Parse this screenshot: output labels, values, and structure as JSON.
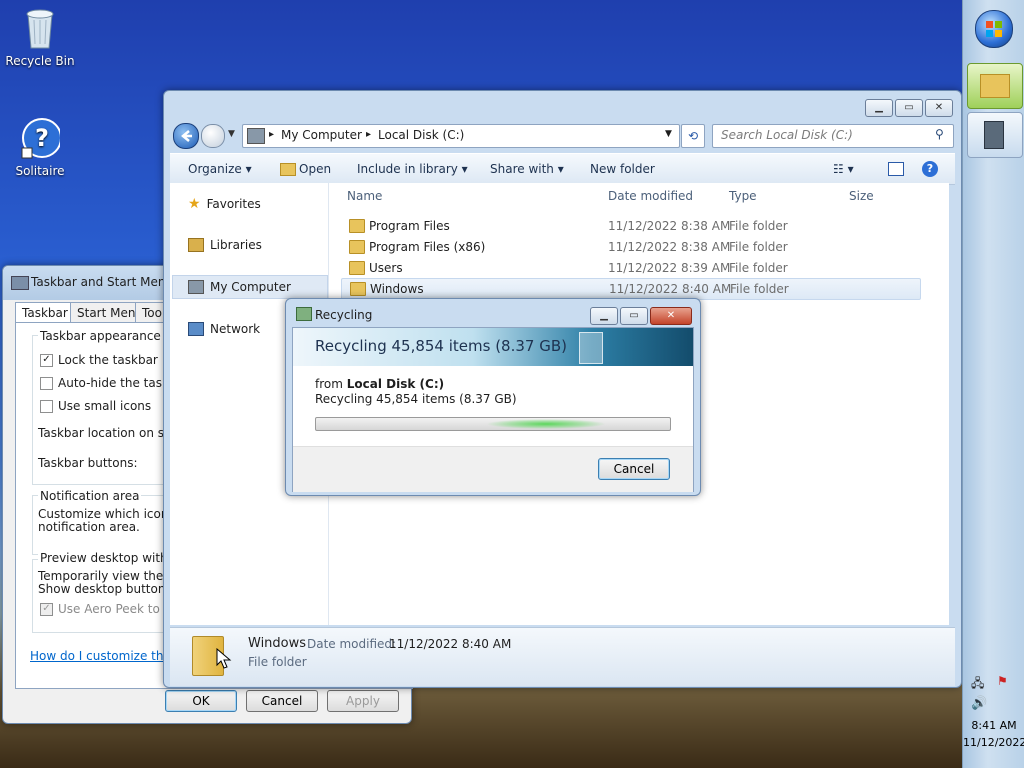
{
  "desktop": {
    "icons": [
      {
        "label": "Recycle Bin",
        "icon": "recycle-bin-icon"
      },
      {
        "label": "Solitaire",
        "icon": "help-icon"
      }
    ]
  },
  "taskbar": {
    "time": "8:41 AM",
    "date": "11/12/2022"
  },
  "explorer": {
    "breadcrumb": [
      "My Computer",
      "Local Disk (C:)"
    ],
    "search_placeholder": "Search Local Disk (C:)",
    "toolbar": {
      "organize": "Organize",
      "open": "Open",
      "include": "Include in library",
      "share": "Share with",
      "newfolder": "New folder"
    },
    "nav": {
      "favorites": "Favorites",
      "libraries": "Libraries",
      "computer": "My Computer",
      "network": "Network"
    },
    "columns": {
      "name": "Name",
      "date": "Date modified",
      "type": "Type",
      "size": "Size"
    },
    "rows": [
      {
        "name": "Program Files",
        "date": "11/12/2022 8:38 AM",
        "type": "File folder"
      },
      {
        "name": "Program Files (x86)",
        "date": "11/12/2022 8:38 AM",
        "type": "File folder"
      },
      {
        "name": "Users",
        "date": "11/12/2022 8:39 AM",
        "type": "File folder"
      },
      {
        "name": "Windows",
        "date": "11/12/2022 8:40 AM",
        "type": "File folder"
      }
    ],
    "details": {
      "name": "Windows",
      "date_label": "Date modified:",
      "date": "11/12/2022 8:40 AM",
      "type": "File folder"
    }
  },
  "taskbar_props": {
    "title": "Taskbar and Start Menu P",
    "tabs": [
      "Taskbar",
      "Start Menu",
      "Toolb"
    ],
    "appearance": "Taskbar appearance",
    "lock": "Lock the taskbar",
    "autohide": "Auto-hide the taskbar",
    "small": "Use small icons",
    "location": "Taskbar location on screen",
    "buttons": "Taskbar buttons:",
    "notif_title": "Notification area",
    "notif_text1": "Customize which icons and",
    "notif_text2": "notification area.",
    "preview_title": "Preview desktop with Aero",
    "preview_text1": "Temporarily view the desk",
    "preview_text2": "Show desktop button at e",
    "peek": "Use Aero Peek to prev",
    "help_link": "How do I customize the task",
    "ok": "OK",
    "cancel": "Cancel",
    "apply": "Apply"
  },
  "recycling": {
    "title": "Recycling",
    "headline": "Recycling 45,854 items (8.37 GB)",
    "from_label": "from",
    "from_value": "Local Disk (C:)",
    "status": "Recycling 45,854 items (8.37 GB)",
    "cancel": "Cancel"
  }
}
